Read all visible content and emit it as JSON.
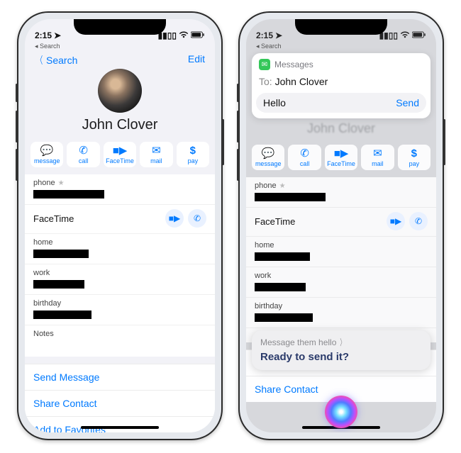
{
  "status": {
    "time": "2:15",
    "back_app": "◂ Search"
  },
  "nav": {
    "back": "Search",
    "edit": "Edit"
  },
  "contact": {
    "name": "John Clover"
  },
  "actions": {
    "message": "message",
    "call": "call",
    "facetime": "FaceTime",
    "mail": "mail",
    "pay": "pay"
  },
  "fields": {
    "phone": "phone",
    "facetime": "FaceTime",
    "home": "home",
    "work": "work",
    "birthday": "birthday",
    "notes": "Notes"
  },
  "links": {
    "send_message": "Send Message",
    "share_contact": "Share Contact",
    "add_favorites": "Add to Favorites"
  },
  "msg": {
    "app": "Messages",
    "to_label": "To:",
    "to_name": "John Clover",
    "body": "Hello",
    "send": "Send"
  },
  "siri": {
    "sub": "Message them hello",
    "main": "Ready to send it?"
  },
  "redact_widths": {
    "phone": 100,
    "home": 78,
    "work": 72,
    "birthday": 82
  }
}
